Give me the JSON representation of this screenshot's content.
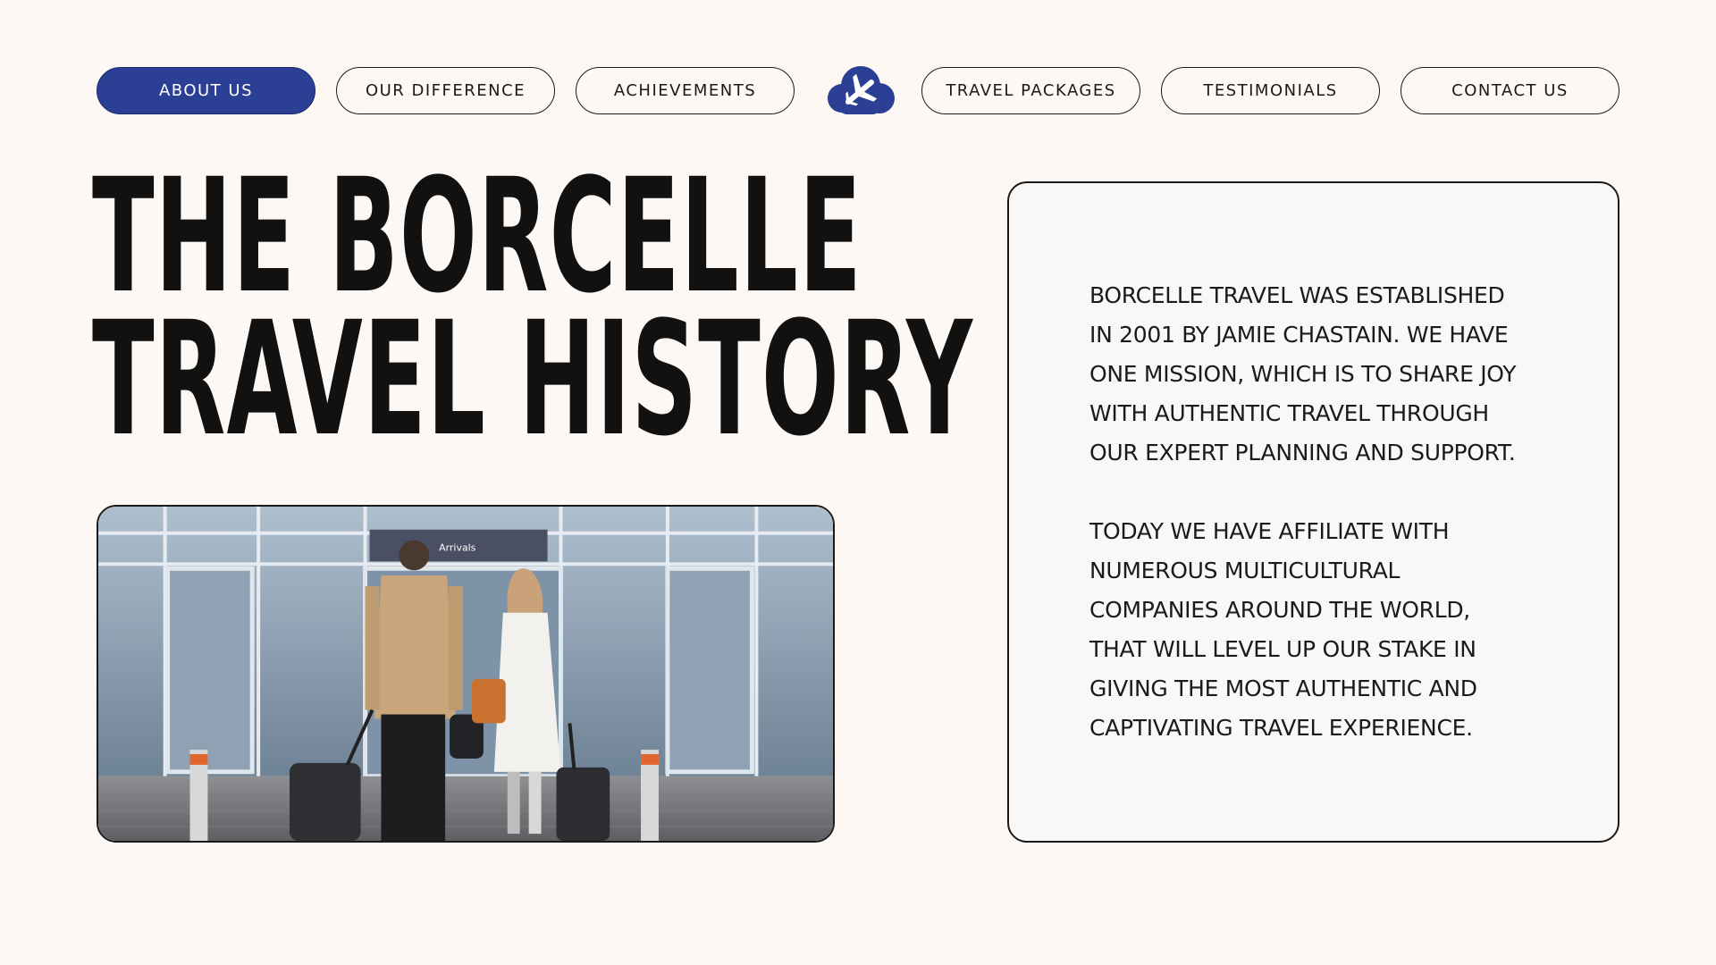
{
  "nav": {
    "left_items": [
      {
        "label": "ABOUT US",
        "active": true
      },
      {
        "label": "OUR DIFFERENCE",
        "active": false
      },
      {
        "label": "ACHIEVEMENTS",
        "active": false
      }
    ],
    "right_items": [
      {
        "label": "TRAVEL PACKAGES",
        "active": false
      },
      {
        "label": "TESTIMONIALS",
        "active": false
      },
      {
        "label": "CONTACT US",
        "active": false
      }
    ],
    "logo_icon": "cloud-airplane-icon"
  },
  "headline": {
    "line1": "THE BORCELLE",
    "line2": "TRAVEL HISTORY"
  },
  "photo": {
    "sign_text": "Arrivals"
  },
  "card": {
    "paragraph1": "BORCELLE TRAVEL WAS ESTABLISHED\nIN 2001 BY JAMIE CHASTAIN. WE HAVE\nONE MISSION, WHICH IS TO SHARE JOY\nWITH AUTHENTIC TRAVEL THROUGH\nOUR EXPERT PLANNING AND SUPPORT.",
    "paragraph2": "TODAY WE HAVE AFFILIATE WITH\nNUMEROUS MULTICULTURAL\nCOMPANIES AROUND THE WORLD,\nTHAT WILL LEVEL UP OUR STAKE IN\nGIVING THE MOST AUTHENTIC AND\nCAPTIVATING TRAVEL EXPERIENCE."
  },
  "colors": {
    "background": "#fdf8f3",
    "accent": "#2b3f94",
    "text": "#111111"
  }
}
